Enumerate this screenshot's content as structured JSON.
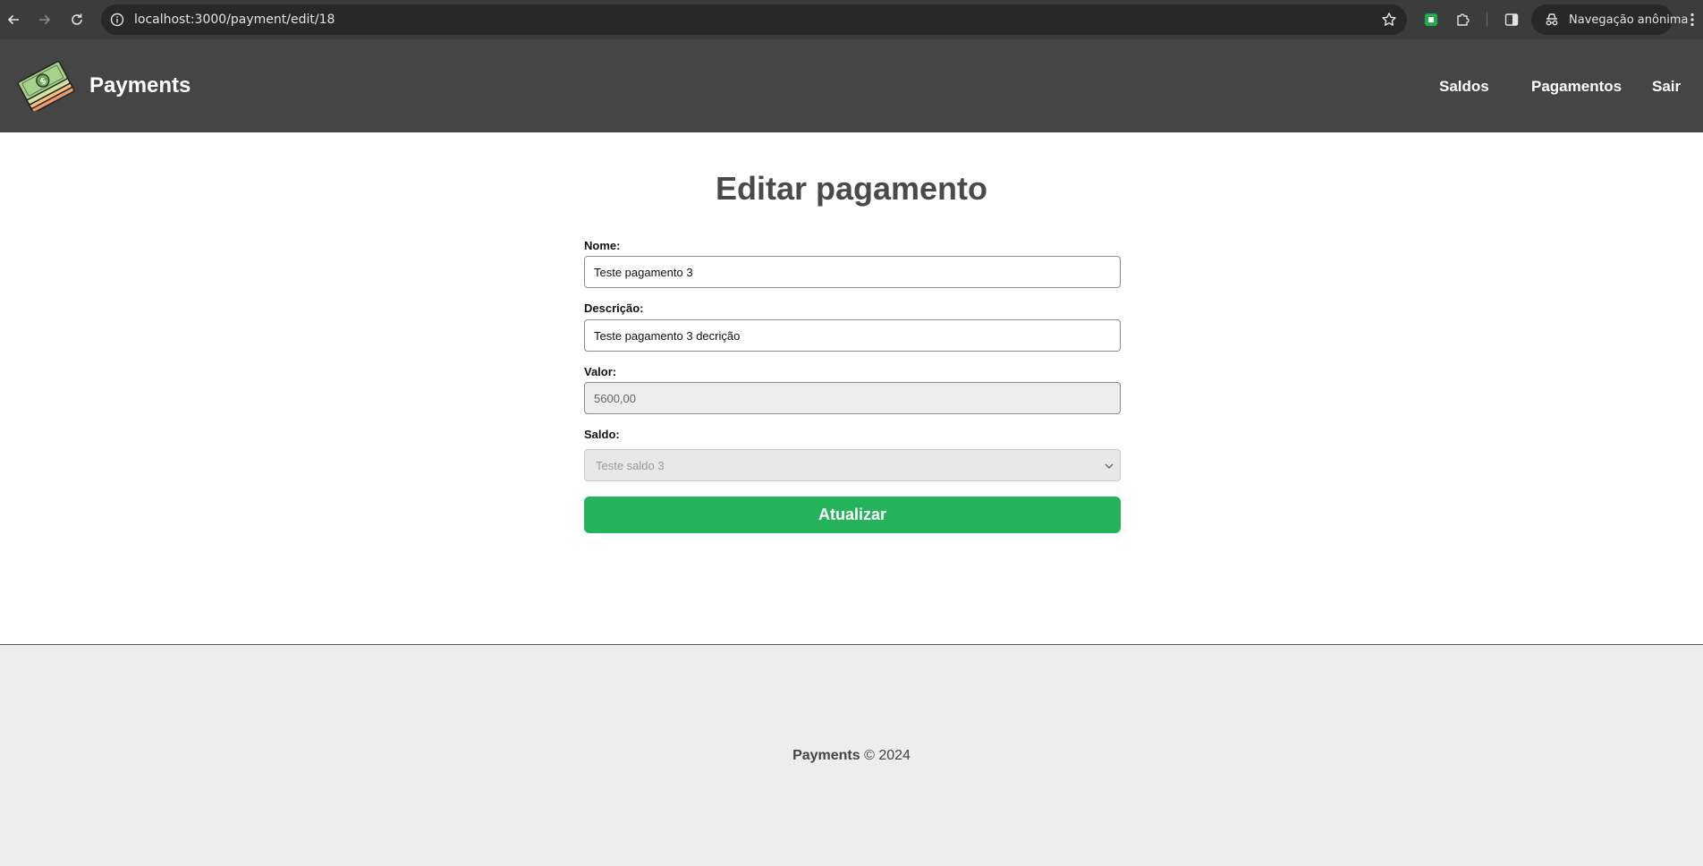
{
  "browser": {
    "url": "localhost:3000/payment/edit/18",
    "incognito_label": "Navegação anônima"
  },
  "header": {
    "brand": "Payments",
    "nav": [
      {
        "label": "Saldos"
      },
      {
        "label": "Pagamentos"
      },
      {
        "label": "Sair"
      }
    ]
  },
  "form": {
    "title": "Editar pagamento",
    "name_label": "Nome:",
    "name_value": "Teste pagamento 3",
    "description_label": "Descrição:",
    "description_value": "Teste pagamento 3 decrição",
    "value_label": "Valor:",
    "value_value": "5600,00",
    "balance_label": "Saldo:",
    "balance_selected": "Teste saldo 3",
    "submit_label": "Atualizar"
  },
  "footer": {
    "brand": "Payments",
    "copyright": "© 2024"
  },
  "colors": {
    "header_bg": "#454545",
    "accent_green": "#24b35a",
    "footer_bg": "#ededed"
  }
}
